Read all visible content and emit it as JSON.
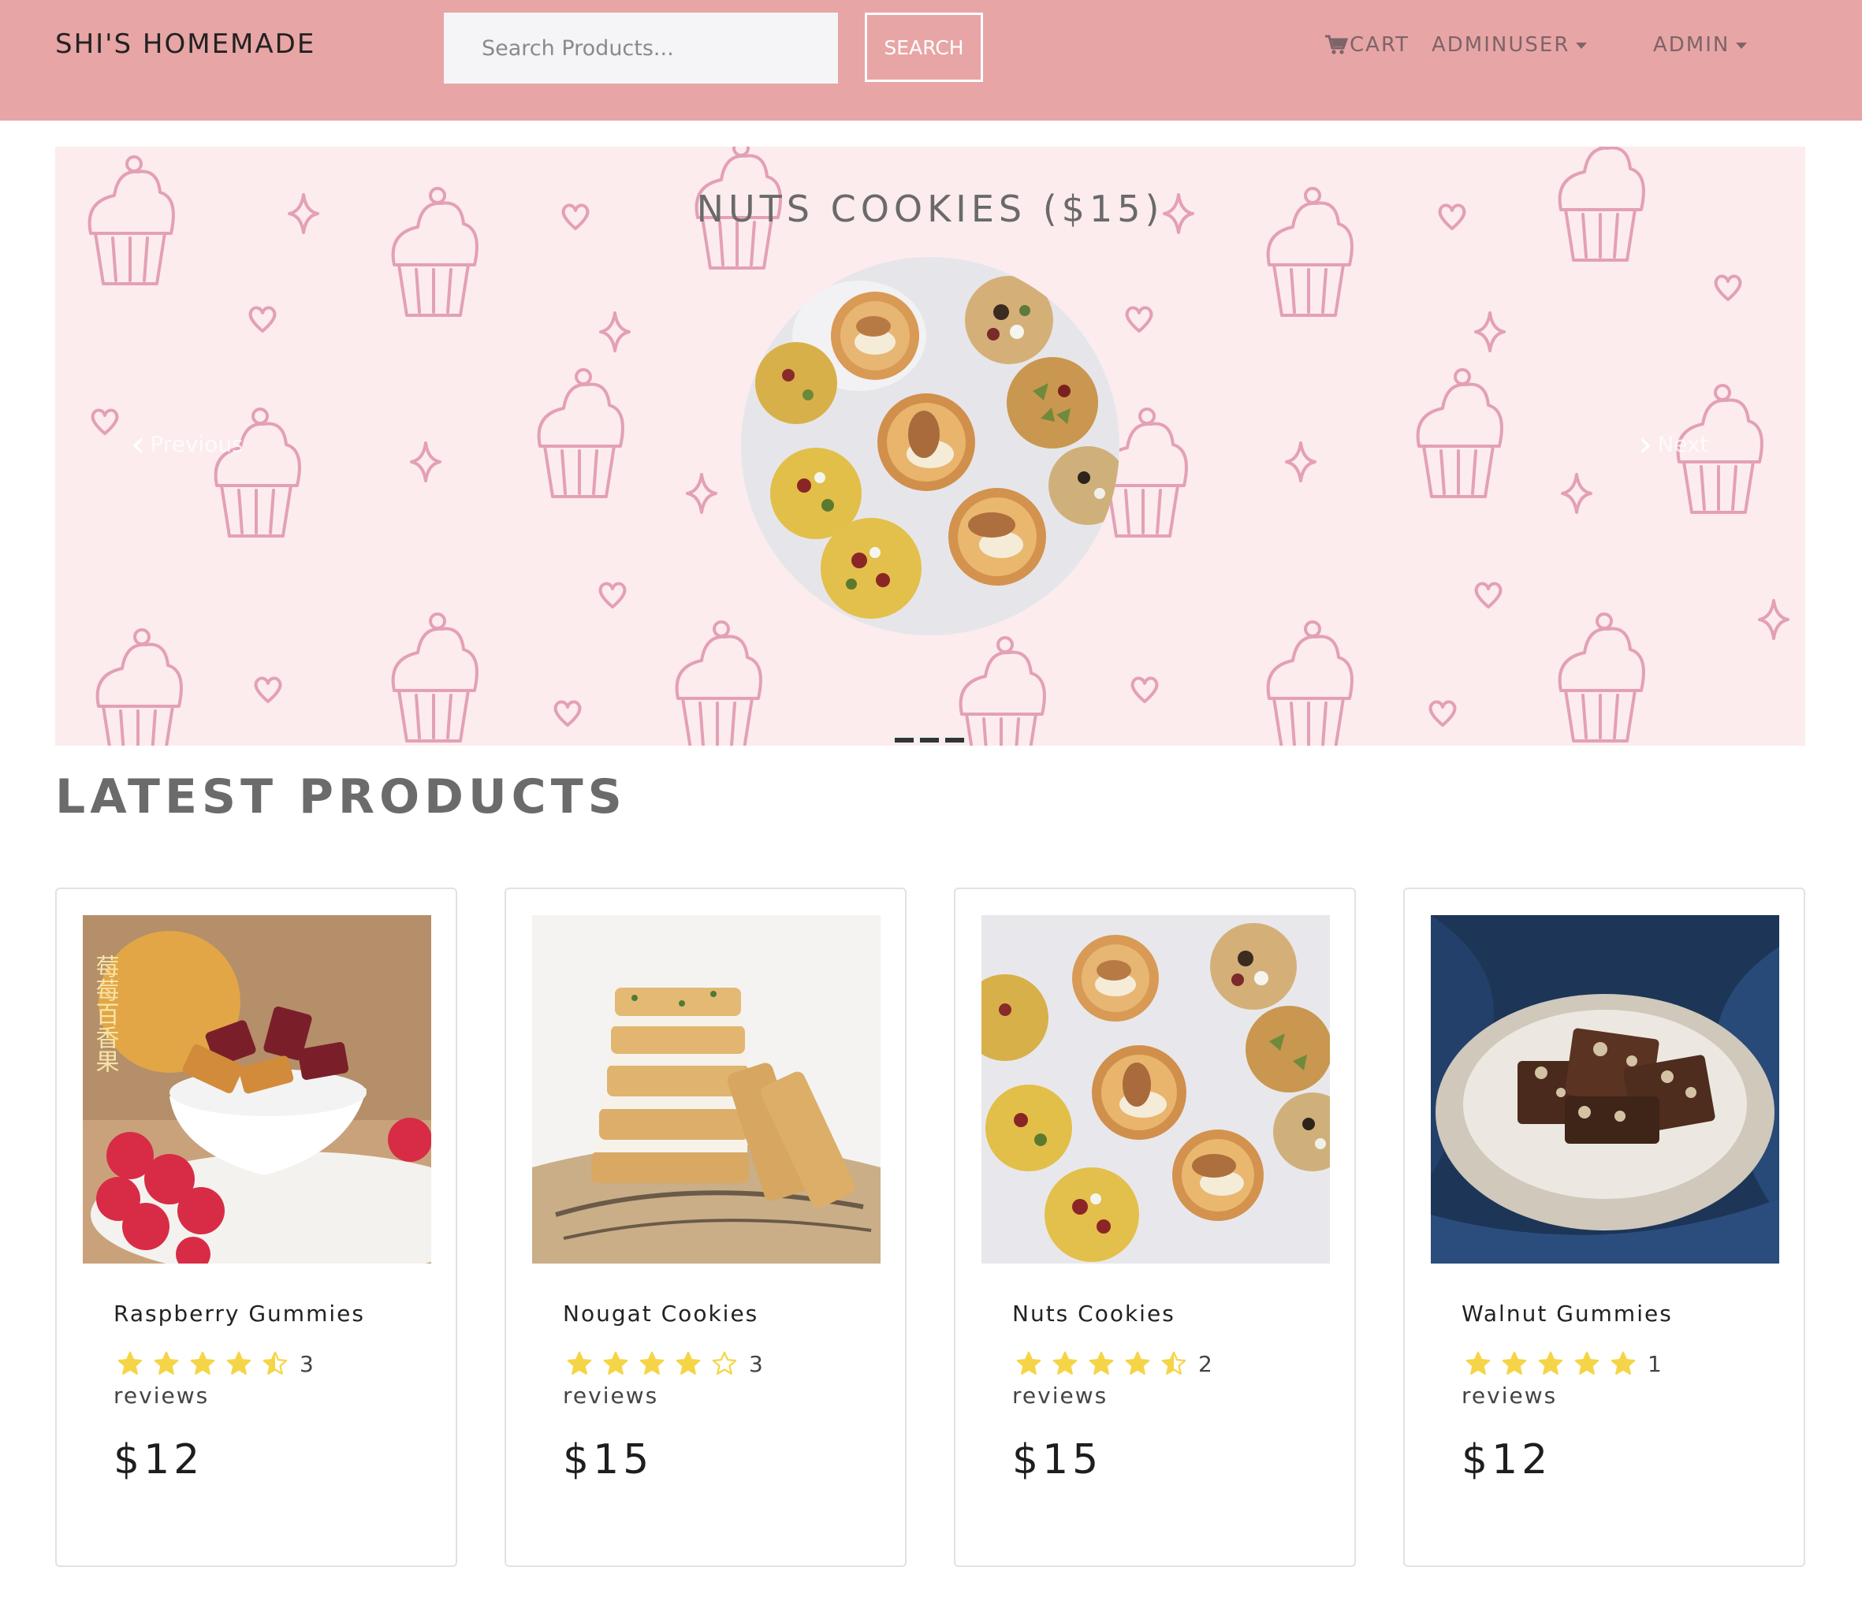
{
  "navbar": {
    "brand": "SHI'S HOMEMADE",
    "search_placeholder": "Search Products...",
    "search_button": "SEARCH",
    "cart_label": "CART",
    "user_label": "ADMINUSER",
    "admin_label": "ADMIN"
  },
  "carousel": {
    "caption": "NUTS COOKIES ($15)",
    "prev_label": "Previous",
    "next_label": "Next",
    "slide_count": 3,
    "active_slide": 1
  },
  "section": {
    "title": "LATEST PRODUCTS"
  },
  "products": [
    {
      "name": "Raspberry Gummies",
      "rating": 4.5,
      "review_count": "3",
      "review_word": "reviews",
      "price": "$12"
    },
    {
      "name": "Nougat Cookies",
      "rating": 4,
      "review_count": "3",
      "review_word": "reviews",
      "price": "$15"
    },
    {
      "name": "Nuts Cookies",
      "rating": 4.5,
      "review_count": "2",
      "review_word": "reviews",
      "price": "$15"
    },
    {
      "name": "Walnut Gummies",
      "rating": 5,
      "review_count": "1",
      "review_word": "reviews",
      "price": "$12"
    }
  ],
  "colors": {
    "navbar_bg": "#e8a5a5",
    "carousel_bg": "#fcecee",
    "pattern_stroke": "#e3a0b6",
    "star": "#f5d547"
  },
  "image_text": {
    "raspberry_gummies_label": "莓莓百香果"
  }
}
